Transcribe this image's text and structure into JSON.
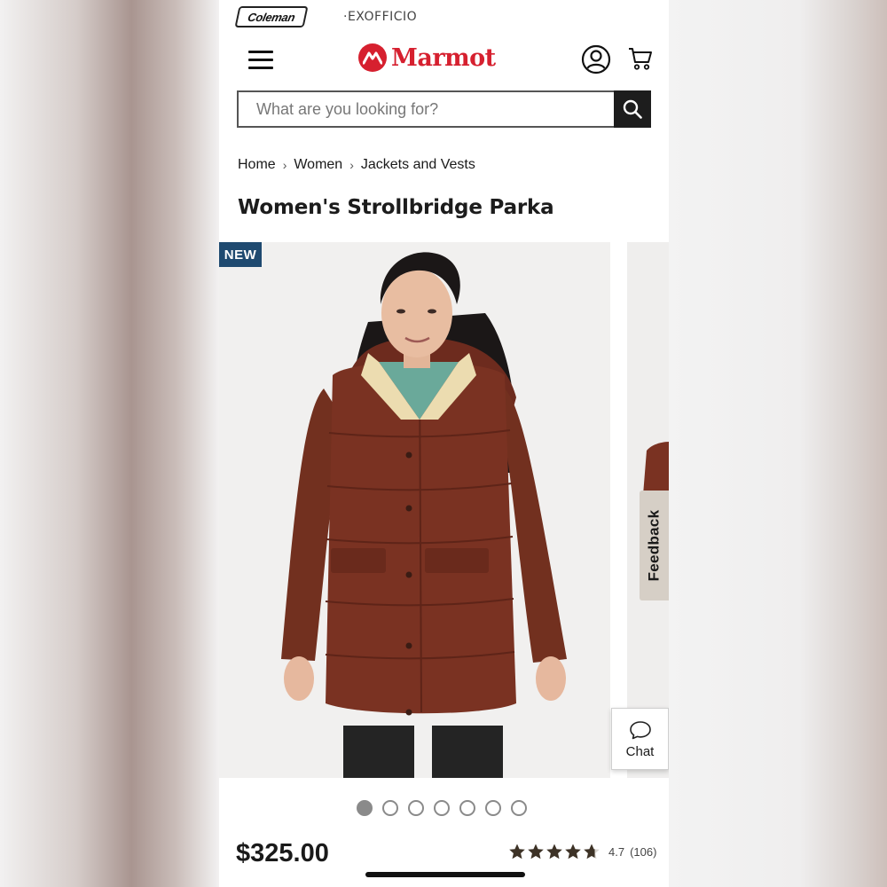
{
  "brands": {
    "coleman": "Coleman",
    "exofficio": "·EXOFFICIO"
  },
  "header": {
    "logo_text": "Marmot"
  },
  "search": {
    "placeholder": "What are you looking for?"
  },
  "breadcrumb": [
    "Home",
    "Women",
    "Jackets and Vests"
  ],
  "product": {
    "title": "Women's Strollbridge Parka",
    "badge": "NEW",
    "price": "$325.00",
    "rating_value": "4.7",
    "rating_count": "(106)",
    "rating_stars": 4.7,
    "jacket_color": "#7a3222"
  },
  "gallery": {
    "image_count": 7,
    "active_index": 0
  },
  "feedback": {
    "label": "Feedback"
  },
  "chat": {
    "label": "Chat"
  },
  "colors": {
    "brand_red": "#d6202f",
    "badge_blue": "#1f4a70",
    "feedback_bg": "#d6cfc6",
    "star": "#3d3226"
  }
}
